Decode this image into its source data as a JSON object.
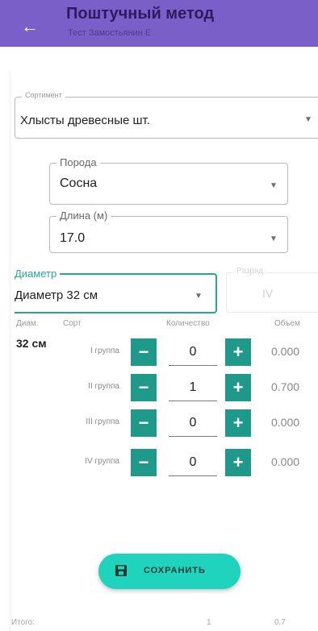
{
  "header": {
    "title": "Поштучный метод",
    "subtitle": "Тест Замостьянин Е",
    "back_icon": "arrow-left-icon"
  },
  "form": {
    "sortiment": {
      "label": "Сортимент",
      "value": "Хлысты древесные шт."
    },
    "poroda": {
      "label": "Порода",
      "value": "Сосна"
    },
    "length": {
      "label": "Длина (м)",
      "value": "17.0"
    },
    "diameter": {
      "label": "Диаметр",
      "value": "Диаметр 32 см"
    },
    "razryad": {
      "label": "Разряд",
      "value": "IV"
    }
  },
  "table": {
    "headers": {
      "diam": "Диам.",
      "sort": "Сорт",
      "quantity": "Количество",
      "volume": "Объем"
    },
    "diam_value": "32 см",
    "rows": [
      {
        "group": "I группа",
        "qty": "0",
        "volume": "0.000"
      },
      {
        "group": "II группа",
        "qty": "1",
        "volume": "0.700"
      },
      {
        "group": "III группа",
        "qty": "0",
        "volume": "0.000"
      },
      {
        "group": "IV группа",
        "qty": "0",
        "volume": "0.000"
      }
    ],
    "minus_symbol": "−",
    "plus_symbol": "+"
  },
  "actions": {
    "save_label": "СОХРАНИТЬ",
    "save_icon": "floppy-disk-icon"
  },
  "footer": {
    "total_label": "Итого:",
    "total_qty": "1",
    "total_volume": "0.7"
  },
  "colors": {
    "appbar": "#7b5fc8",
    "accent": "#26a69a",
    "button": "#1f9a8a",
    "fab": "#20d3bd"
  }
}
